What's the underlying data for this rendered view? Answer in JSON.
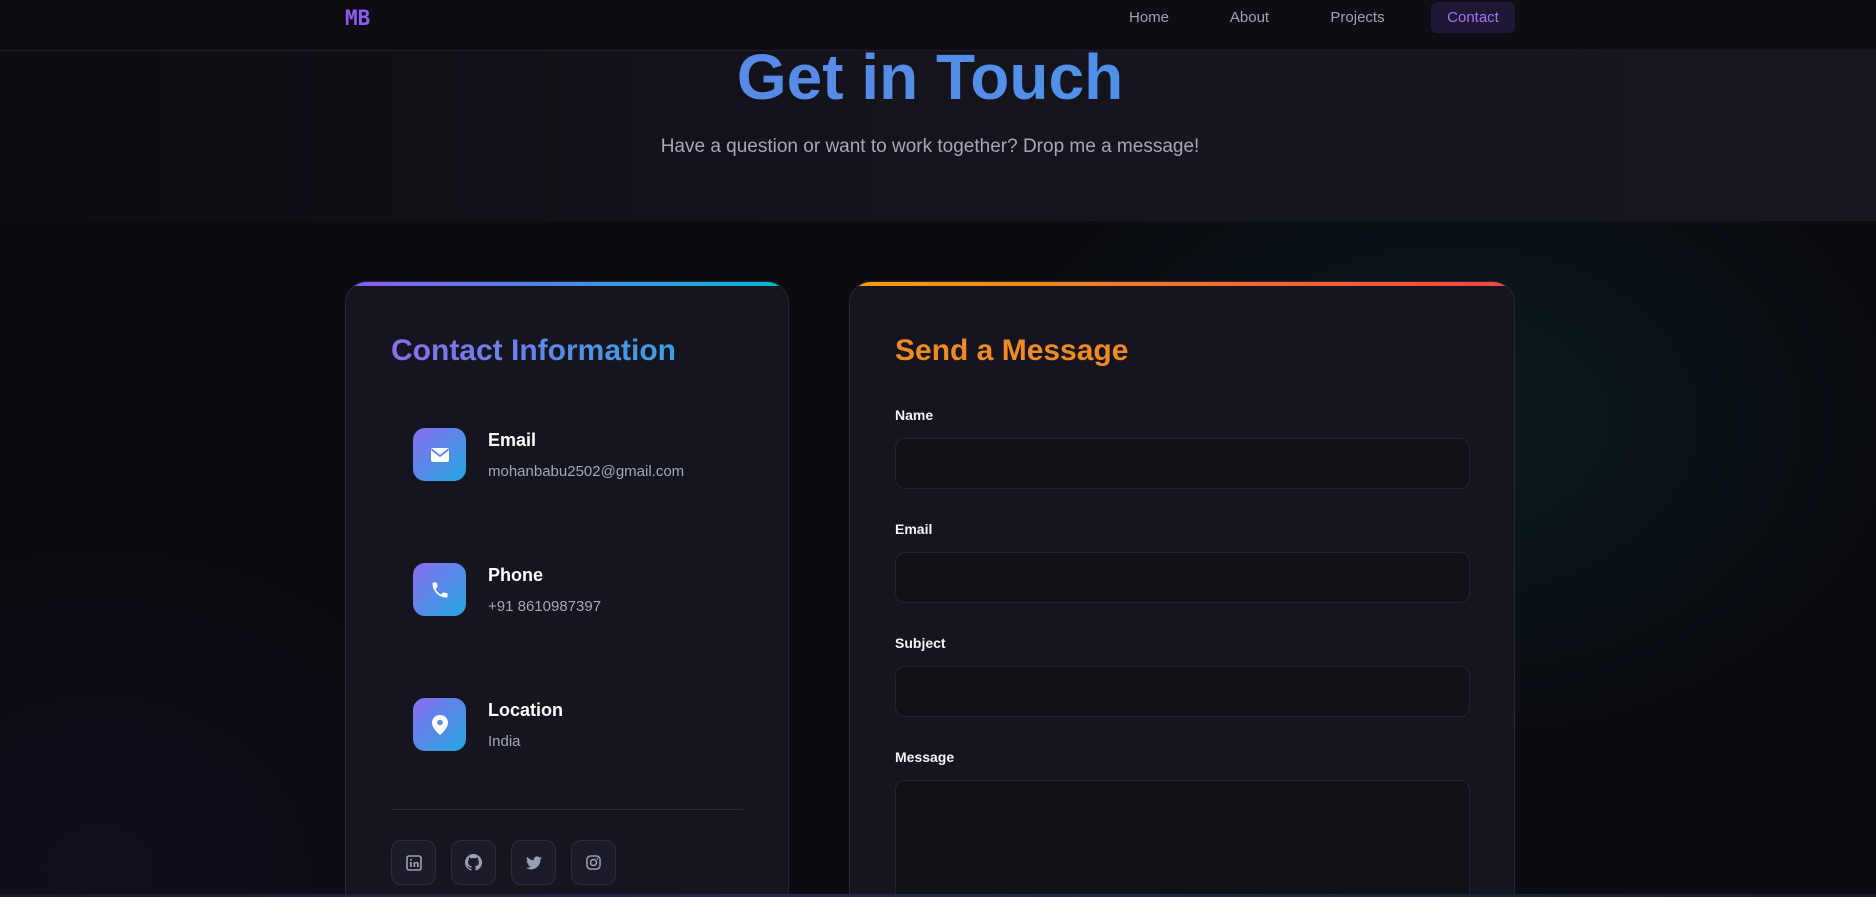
{
  "nav": {
    "logo": "MB",
    "links": [
      {
        "label": "Home"
      },
      {
        "label": "About"
      },
      {
        "label": "Projects"
      },
      {
        "label": "Contact",
        "active": true
      }
    ]
  },
  "hero": {
    "title": "Get in Touch",
    "subtitle": "Have a question or want to work together? Drop me a message!"
  },
  "contact_info": {
    "title": "Contact Information",
    "items": [
      {
        "icon": "envelope-icon",
        "label": "Email",
        "value": "mohanbabu2502@gmail.com"
      },
      {
        "icon": "phone-icon",
        "label": "Phone",
        "value": "+91 8610987397"
      },
      {
        "icon": "location-pin-icon",
        "label": "Location",
        "value": "India"
      }
    ],
    "socials": [
      "linkedin-icon",
      "github-icon",
      "twitter-icon",
      "instagram-icon"
    ]
  },
  "form": {
    "title": "Send a Message",
    "fields": [
      {
        "label": "Name",
        "value": "",
        "placeholder": ""
      },
      {
        "label": "Email",
        "value": "",
        "placeholder": ""
      },
      {
        "label": "Subject",
        "value": "",
        "placeholder": ""
      },
      {
        "label": "Message",
        "value": "",
        "placeholder": ""
      }
    ]
  },
  "colors": {
    "accent_purple": "#8b5cf6",
    "accent_cyan": "#06b6d4",
    "accent_orange": "#f08a24",
    "accent_red": "#ef4444",
    "background": "#0c0c12",
    "card": "#15151f"
  }
}
